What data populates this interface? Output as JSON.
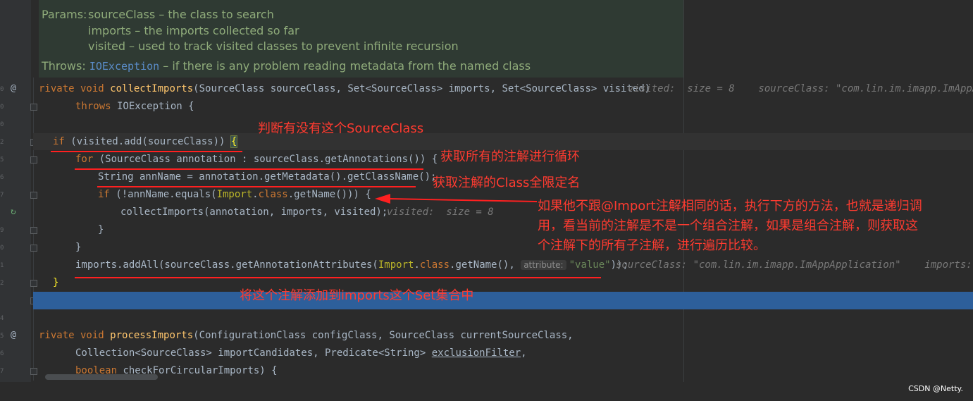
{
  "doc": {
    "params_label": "Params:",
    "param1": "sourceClass – the class to search",
    "param2": "imports – the imports collected so far",
    "param3": "visited – used to track visited classes to prevent infinite recursion",
    "throws_label": "Throws:",
    "throws_exception": "IOException",
    "throws_desc": " – if there is any problem reading metadata from the named class"
  },
  "gutter": {
    "line_marks": [
      "0",
      "0",
      "0",
      "2",
      "5",
      "6",
      "7",
      "8",
      "9",
      "0",
      "1",
      "2",
      "3",
      "4",
      "5",
      "6",
      "7",
      "8",
      "5",
      "6",
      "7",
      "8"
    ],
    "at_icon": "@",
    "recursion_icon": "↻"
  },
  "code": {
    "l1_kw": "rivate void ",
    "l1_fn": "collectImports",
    "l1_rest": "(SourceClass sourceClass, Set<SourceClass> imports, Set<SourceClass> visited)",
    "l1_hint": "visited:  size = 8    sourceClass: \"com.lin.im.imapp.ImAppApp",
    "l2_kw": "throws",
    "l2_rest": " IOException {",
    "l3_kw": "if",
    "l3_rest": " (visited.add(sourceClass)) ",
    "l3_brace": "{",
    "l4_kw": "for",
    "l4_rest": " (SourceClass annotation : sourceClass.getAnnotations()) {",
    "l5": "String annName = annotation.getMetadata().getClassName();",
    "l6_kw": "if",
    "l6_a": " (!annName.equals(",
    "l6_cls": "Import",
    "l6_dot": ".",
    "l6_kw2": "class",
    "l6_b": ".getName())) {",
    "l7": "collectImports(annotation, imports, visited);",
    "l7_hint": "visited:  size = 8",
    "l8": "}",
    "l9": "}",
    "l10_a": "imports.addAll(sourceClass.getAnnotationAttributes(",
    "l10_cls": "Import",
    "l10_dot": ".",
    "l10_kw": "class",
    "l10_b": ".getName(), ",
    "l10_param": "attribute:",
    "l10_str": "\"value\"",
    "l10_c": "));",
    "l10_hint": "sourceClass: \"com.lin.im.imapp.ImAppApplication\"    imports:  s",
    "l11": "}",
    "l12_kw": "rivate void ",
    "l12_fn": "processImports",
    "l12_rest": "(ConfigurationClass configClass, SourceClass currentSourceClass,",
    "l13_a": "Collection<SourceClass> importCandidates, Predicate<String> ",
    "l13_u": "exclusionFilter",
    "l13_b": ",",
    "l14_kw": "boolean",
    "l14_rest": " checkForCircularImports) {"
  },
  "annotations": {
    "a1": "判断有没有这个SourceClass",
    "a2": "获取所有的注解进行循环",
    "a3": "获取注解的Class全限定名",
    "a4": "如果他不跟@Import注解相同的话，执行下方的方法，也就是递归调\n用，看当前的注解是不是一个组合注解，如果是组合注解，则获取这\n个注解下的所有子注解，进行遍历比较。",
    "a5": "将这个注解添加到imports这个Set集合中"
  },
  "watermark": "CSDN @Netty.",
  "colors": {
    "background": "#2b2b2b",
    "keyword": "#cc7832",
    "function": "#ffc66d",
    "annotation_red": "#ff3b30",
    "selection": "#2d5f9b",
    "doc_text": "#8fab7a"
  }
}
